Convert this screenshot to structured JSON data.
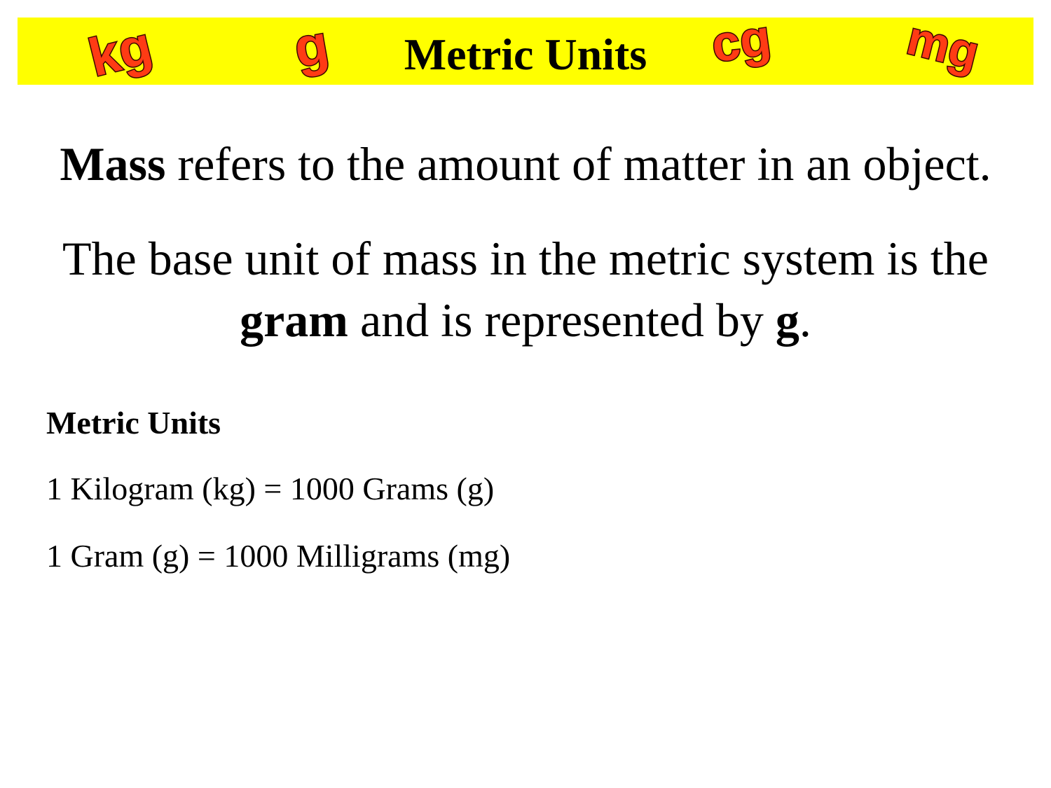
{
  "header": {
    "title": "Metric Units",
    "bar_color": "#ffff00",
    "unit_art": [
      "kg",
      "g",
      "cg",
      "mg"
    ],
    "unit_art_color": "#ff3b14"
  },
  "definition": {
    "mass_term": "Mass",
    "mass_text": " refers to the amount of matter in an object."
  },
  "base_unit": {
    "line1": "The base unit of mass in the metric system is the",
    "gram_term": "gram",
    "middle": " and is represented by ",
    "symbol": "g",
    "end": "."
  },
  "metric_list": {
    "heading": "Metric Units",
    "items": [
      "1 Kilogram (kg) = 1000 Grams (g)",
      "1 Gram (g) = 1000 Milligrams (mg)"
    ]
  }
}
